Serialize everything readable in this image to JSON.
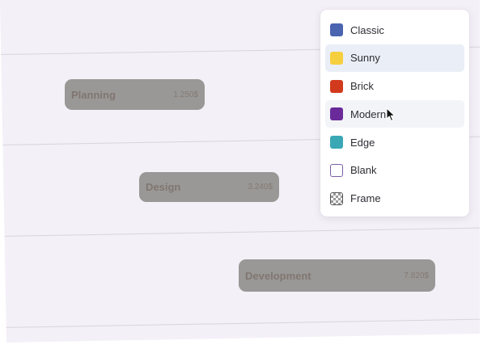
{
  "tasks": [
    {
      "name": "Planning",
      "value": "1.250$"
    },
    {
      "name": "Design",
      "value": "3.240$"
    },
    {
      "name": "Development",
      "value": "7.820$"
    }
  ],
  "style_menu": {
    "selected": "Sunny",
    "hovered": "Modern",
    "options": [
      {
        "label": "Classic",
        "color": "#4a64b0",
        "swatch": "solid"
      },
      {
        "label": "Sunny",
        "color": "#f5cf3e",
        "swatch": "solid"
      },
      {
        "label": "Brick",
        "color": "#d23a1e",
        "swatch": "solid"
      },
      {
        "label": "Modern",
        "color": "#6a2a9a",
        "swatch": "solid"
      },
      {
        "label": "Edge",
        "color": "#3aa8b4",
        "swatch": "solid"
      },
      {
        "label": "Blank",
        "color": "#ffffff",
        "swatch": "outline"
      },
      {
        "label": "Frame",
        "color": "#9a9a9a",
        "swatch": "checker"
      }
    ]
  },
  "colors": {
    "canvas_background": "#f4f0f7",
    "task_bar": "#9a9896",
    "task_text": "#807671",
    "selected_option_background": "#eaeef6"
  }
}
